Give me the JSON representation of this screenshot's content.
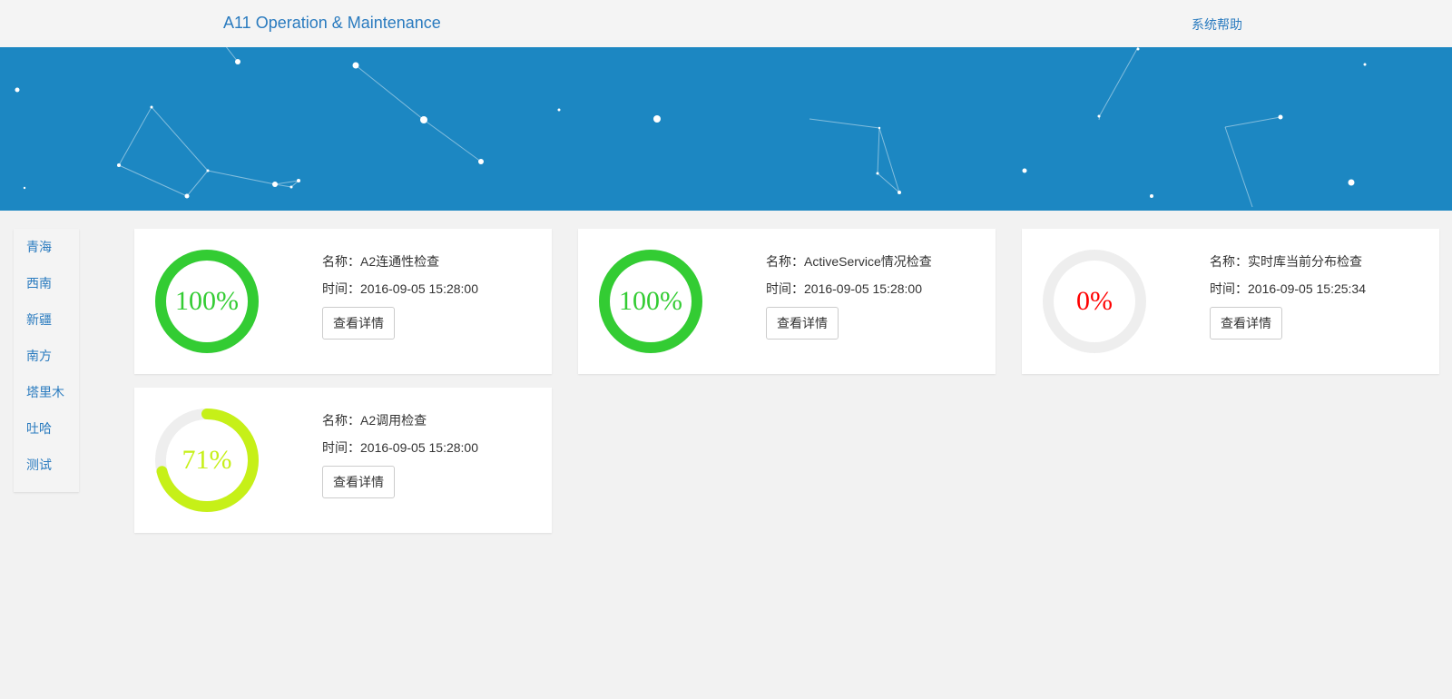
{
  "header": {
    "brand": "A11 Operation & Maintenance",
    "help_link": "系统帮助"
  },
  "colors": {
    "accent": "#2a7bbf",
    "banner": "#1c87c2",
    "ok": "#33cc33",
    "warn": "#c6f018",
    "fail": "#ff0000",
    "track": "#eeeeee"
  },
  "sidebar": {
    "items": [
      {
        "label": "青海"
      },
      {
        "label": "西南"
      },
      {
        "label": "新疆"
      },
      {
        "label": "南方"
      },
      {
        "label": "塔里木"
      },
      {
        "label": "吐哈"
      },
      {
        "label": "测试"
      }
    ]
  },
  "checks": [
    {
      "percent": 100,
      "percent_label": "100%",
      "color": "#33cc33",
      "name": "名称：A2连通性检查",
      "time": "时间：2016-09-05 15:28:00",
      "button": "查看详情"
    },
    {
      "percent": 100,
      "percent_label": "100%",
      "color": "#33cc33",
      "name": "名称：ActiveService情况检查",
      "time": "时间：2016-09-05 15:28:00",
      "button": "查看详情"
    },
    {
      "percent": 0,
      "percent_label": "0%",
      "color": "#ff0000",
      "name": "名称：实时库当前分布检查",
      "time": "时间：2016-09-05 15:25:34",
      "button": "查看详情"
    },
    {
      "percent": 71,
      "percent_label": "71%",
      "color": "#c6f018",
      "name": "名称：A2调用检查",
      "time": "时间：2016-09-05 15:28:00",
      "button": "查看详情"
    }
  ]
}
